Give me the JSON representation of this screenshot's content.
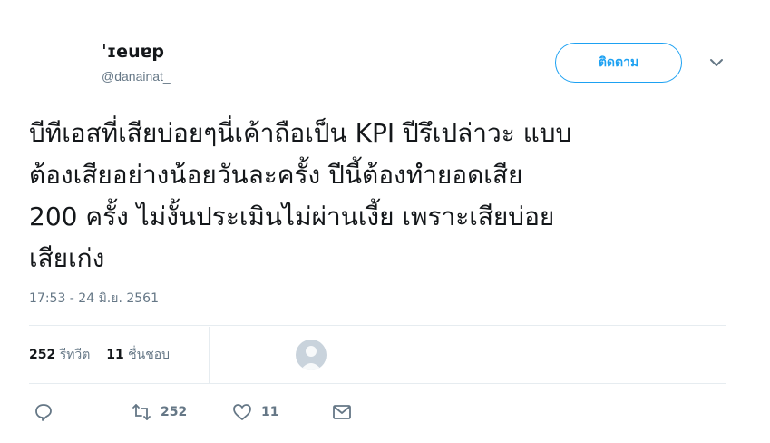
{
  "profile": {
    "name": "ˈɪeuɐp",
    "handle": "@danainat_"
  },
  "follow_button": {
    "label": "ติดตาม"
  },
  "tweet": {
    "lines": [
      "บีทีเอสที่เสียบ่อยๆนี่เค้าถือเป็น KPI ปีรึเปล่าวะ แบบ",
      "ต้องเสียอย่างน้อยวันละครั้ง ปีนี้ต้องทำยอดเสีย",
      "200 ครั้ง ไม่งั้นประเมินไม่ผ่านเงี้ย เพราะเสียบ่อย",
      "เสียเก่ง"
    ],
    "timestamp": "17:53 - 24 มิ.ย. 2561"
  },
  "stats": {
    "retweets_count": "252",
    "retweets_label": "รีทวีต",
    "likes_count": "11",
    "likes_label": "ชื่นชอบ"
  },
  "actions": {
    "retweet_count": "252",
    "like_count": "11"
  },
  "icons": [
    "chevron-down-icon",
    "reply-icon",
    "retweet-icon",
    "heart-icon",
    "mail-icon",
    "avatar"
  ]
}
